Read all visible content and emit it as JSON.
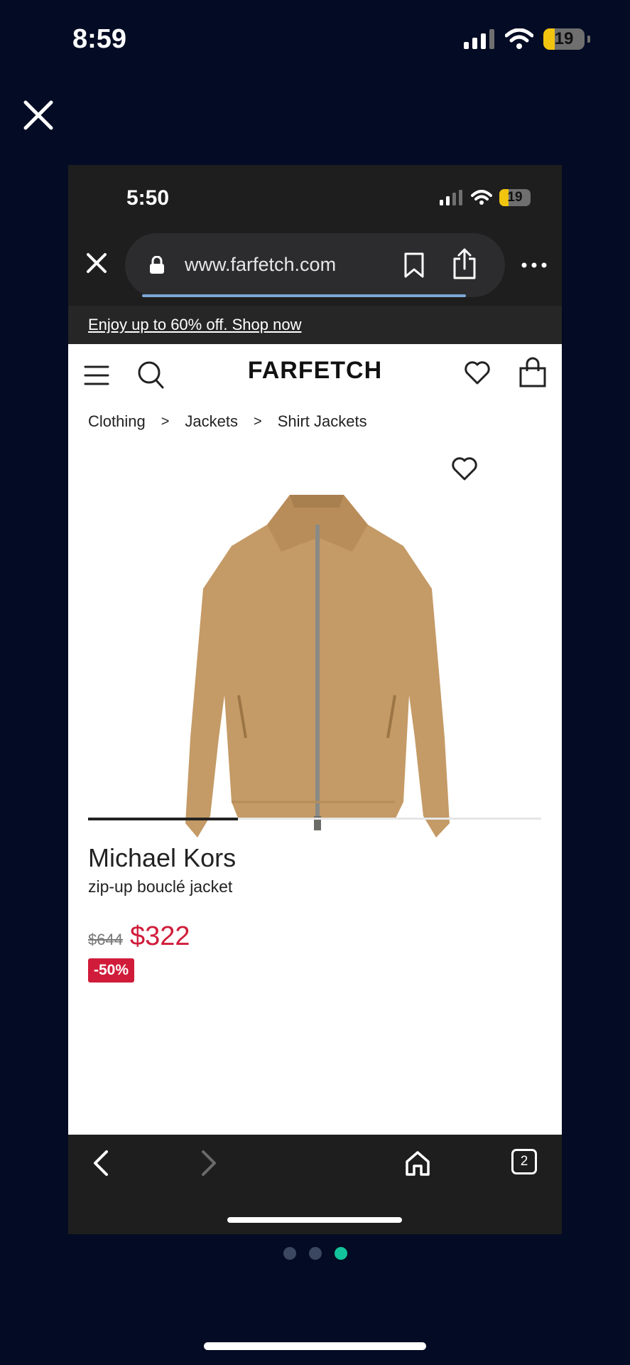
{
  "outer_status": {
    "time": "8:59",
    "battery": "19"
  },
  "browser": {
    "status_time": "5:50",
    "battery": "19",
    "url": "www.farfetch.com",
    "tab_count": "2"
  },
  "promo": {
    "text": "Enjoy up to 60% off. Shop now"
  },
  "site": {
    "logo": "FARFETCH"
  },
  "breadcrumb": [
    "Clothing",
    "Jackets",
    "Shirt Jackets"
  ],
  "breadcrumb_sep": ">",
  "product": {
    "brand": "Michael Kors",
    "name": "zip-up bouclé jacket",
    "old_price": "$644",
    "price": "$322",
    "discount": "-50%",
    "image_progress": 0.33,
    "color": "#c49a66"
  },
  "carousel": {
    "pages": 3,
    "active": 2
  },
  "colors": {
    "background": "#030c24",
    "sale": "#d01c3a",
    "dot_active": "#13c39b"
  },
  "icons": [
    "close-icon",
    "lock-icon",
    "bookmark-icon",
    "share-icon",
    "more-icon",
    "menu-icon",
    "search-icon",
    "heart-icon",
    "bag-icon",
    "back-icon",
    "forward-icon",
    "home-icon",
    "tabs-icon"
  ]
}
